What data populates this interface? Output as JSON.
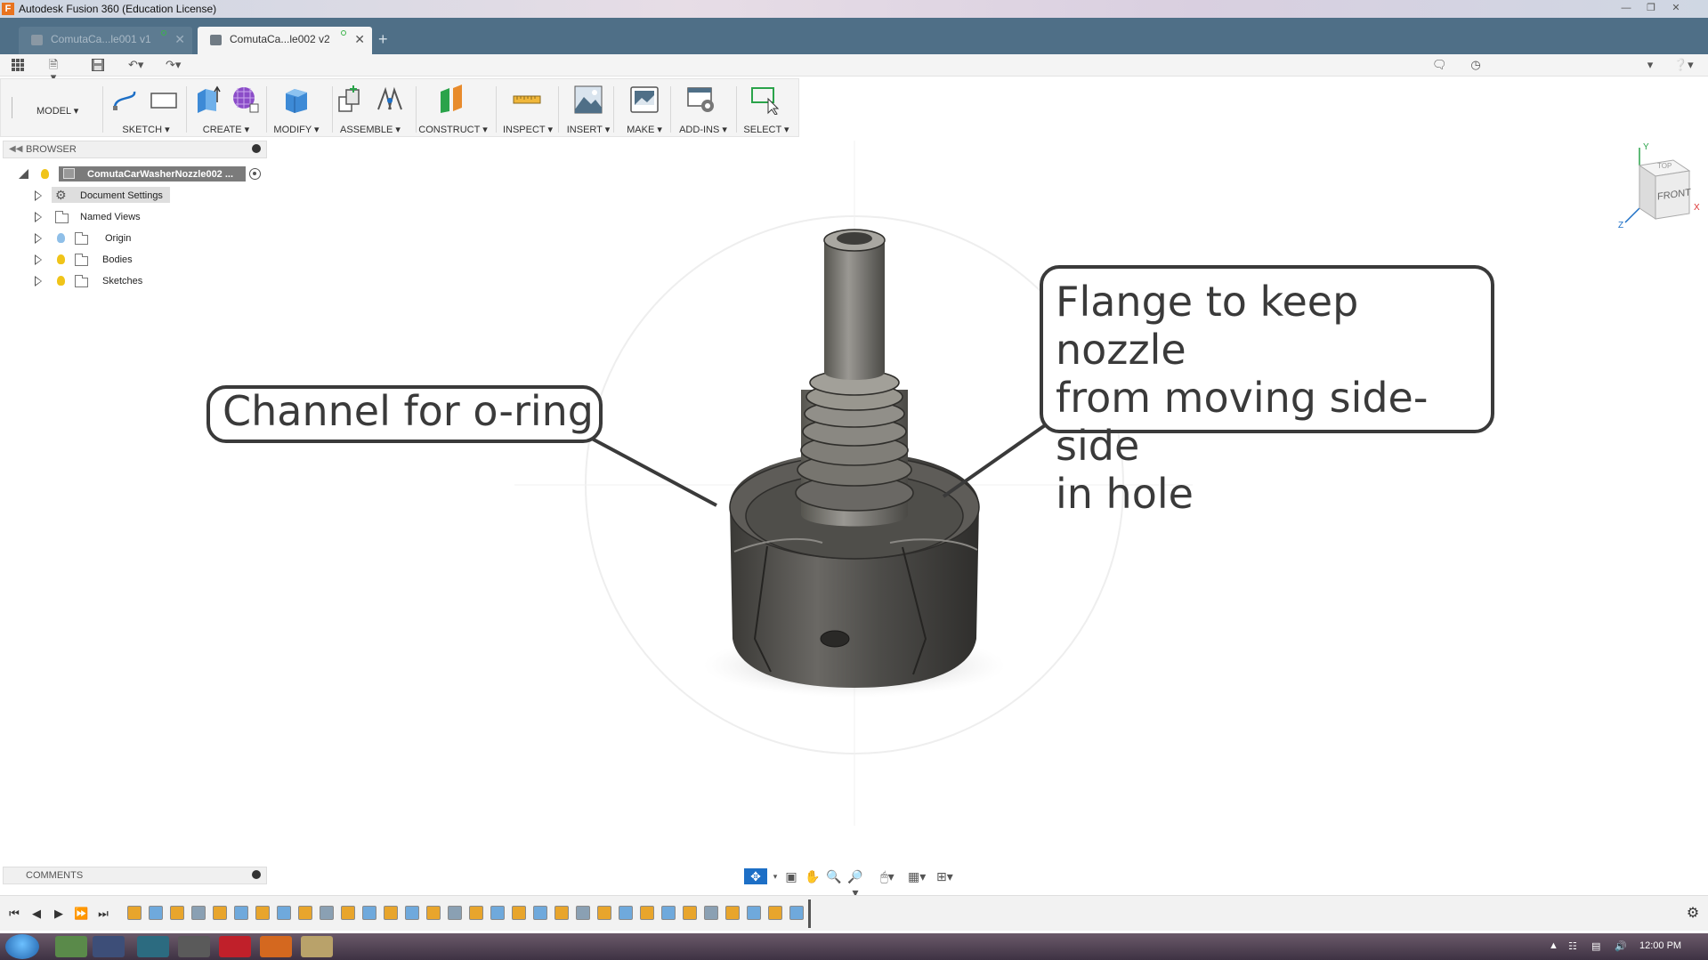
{
  "window": {
    "title": "Autodesk Fusion 360 (Education License)"
  },
  "tabs": [
    {
      "label": "ComutaCa...le001 v1",
      "active": false
    },
    {
      "label": "ComutaCa...le002 v2",
      "active": true
    }
  ],
  "new_tab_label": "+",
  "workspace": {
    "label": "MODEL ▾"
  },
  "ribbon": {
    "groups": [
      {
        "label": "SKETCH ▾"
      },
      {
        "label": "CREATE ▾"
      },
      {
        "label": "MODIFY ▾"
      },
      {
        "label": "ASSEMBLE ▾"
      },
      {
        "label": "CONSTRUCT ▾"
      },
      {
        "label": "INSPECT ▾"
      },
      {
        "label": "INSERT ▾"
      },
      {
        "label": "MAKE ▾"
      },
      {
        "label": "ADD-INS ▾"
      },
      {
        "label": "SELECT ▾"
      }
    ]
  },
  "browser": {
    "title": "BROWSER",
    "root": "ComutaCarWasherNozzle002 ...",
    "items": [
      {
        "label": "Document Settings"
      },
      {
        "label": "Named Views"
      },
      {
        "label": "Origin"
      },
      {
        "label": "Bodies"
      },
      {
        "label": "Sketches"
      }
    ]
  },
  "viewcube": {
    "face_front": "FRONT",
    "face_top": "TOP",
    "axis_x": "X",
    "axis_y": "Y",
    "axis_z": "Z"
  },
  "callouts": {
    "left": "Channel for o-ring",
    "right_line1": "Flange to keep nozzle",
    "right_line2": "from moving side-side",
    "right_line3": "in hole"
  },
  "comments": {
    "title": "COMMENTS"
  },
  "taskbar": {
    "time": "12:00 PM"
  },
  "colors": {
    "tab_bar": "#4f6f87",
    "model_dark": "#4b4a47",
    "callout_stroke": "#3a3a3a",
    "nav_active": "#1d6fc6"
  }
}
